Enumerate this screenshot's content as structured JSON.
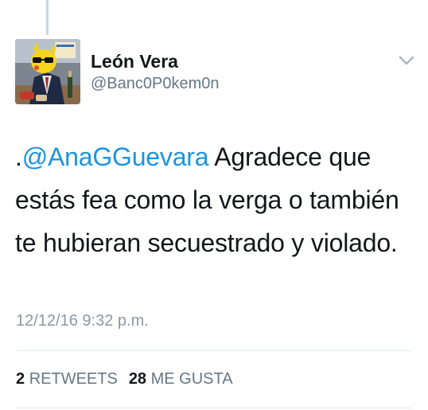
{
  "tweet": {
    "display_name": "León Vera",
    "username": "@Banc0P0kem0n",
    "text_prefix": ".",
    "mention": "@AnaGGuevara",
    "text_body": " Agradece que estás fea como la verga o también te hubieran secuestrado y violado.",
    "timestamp": "12/12/16 9:32 p.m.",
    "retweets_count": "2",
    "retweets_label": "RETWEETS",
    "likes_count": "28",
    "likes_label": "ME GUSTA"
  },
  "icons": {
    "menu": "chevron-down-icon",
    "avatar": "avatar-image"
  },
  "colors": {
    "mention": "#1b95e0",
    "secondary_text": "#657786",
    "timestamp": "#8899a6",
    "divider": "#e1e8ed"
  }
}
